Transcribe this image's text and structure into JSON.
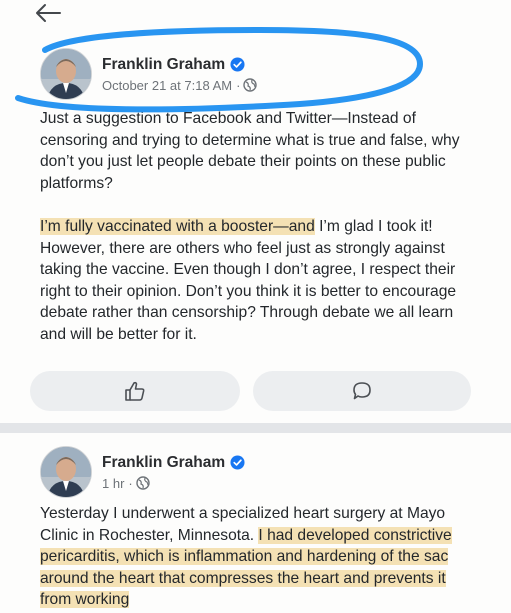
{
  "post1": {
    "author_name": "Franklin Graham",
    "timestamp": "October 21 at 7:18 AM",
    "dot": "·",
    "para1": "Just a suggestion to Facebook and Twitter—Instead of censoring and trying to determine what is true and false, why don’t you just let people debate their points on these public platforms?",
    "para2_highlight": "I’m fully vaccinated with a booster—and",
    "para2_rest": " I’m glad I took it! However, there are others who feel just as strongly against taking the vaccine. Even though I don’t agree, I respect their right to their opinion. Don’t you think it is better to encourage debate rather than censorship? Through debate we all learn and will be better for it.",
    "like_icon": "thumbs-up-icon",
    "comment_icon": "comment-bubble-icon"
  },
  "post2": {
    "author_name": "Franklin Graham",
    "timestamp": "1 hr",
    "dot": "·",
    "text_plain": "Yesterday I underwent a specialized heart surgery at Mayo Clinic in Rochester, Minnesota. ",
    "text_highlight": "I had developed constrictive pericarditis, which is inflammation and hardening of the sac around the heart that compresses the heart and prevents it from working"
  },
  "colors": {
    "highlight": "#f4e1b4",
    "annotation_blue": "#1e8ff0",
    "verified_blue": "#1877f2",
    "divider": "#e3e5e8"
  }
}
